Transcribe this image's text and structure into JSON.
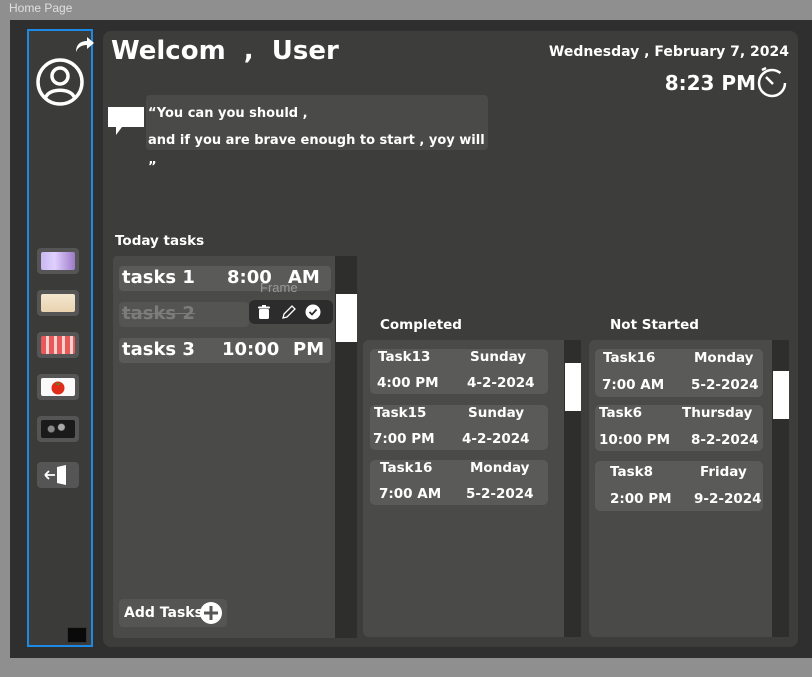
{
  "window": {
    "title": "Home Page"
  },
  "header": {
    "welcome": "Welcom  ,  User",
    "date": "Wednesday , February 7, 2024",
    "time": "8:23 PM"
  },
  "quote": {
    "line1": "“You can you should ,",
    "line2": "and if you are brave enough to start , yoy will ”"
  },
  "sidebar": {
    "items": [
      "tasks-image",
      "notes-image",
      "calendar-image",
      "pomodoro-image",
      "team-image"
    ],
    "logout_icon": "logout-icon"
  },
  "today": {
    "title": "Today tasks",
    "frame_label": "Frame",
    "items": [
      {
        "name": "tasks 1",
        "time": "8:00",
        "ampm": "AM"
      },
      {
        "name": "tasks 2",
        "time": "",
        "ampm": ""
      },
      {
        "name": "tasks 3",
        "time": "10:00",
        "ampm": "PM"
      }
    ],
    "add_label": "Add Tasks"
  },
  "completed": {
    "title": "Completed",
    "tasks": [
      {
        "name": "Task13",
        "day": "Sunday",
        "time": "4:00 PM",
        "date": "4-2-2024"
      },
      {
        "name": "Task15",
        "day": "Sunday",
        "time": "7:00 PM",
        "date": "4-2-2024"
      },
      {
        "name": "Task16",
        "day": "Monday",
        "time": "7:00 AM",
        "date": "5-2-2024"
      }
    ]
  },
  "not_started": {
    "title": "Not Started",
    "tasks": [
      {
        "name": "Task16",
        "day": "Monday",
        "time": "7:00 AM",
        "date": "5-2-2024"
      },
      {
        "name": "Task6",
        "day": "Thursday",
        "time": "10:00 PM",
        "date": "8-2-2024"
      },
      {
        "name": "Task8",
        "day": "Friday",
        "time": "2:00 PM",
        "date": "9-2-2024"
      }
    ]
  },
  "colors": {
    "accent": "#1e88e5",
    "panel": "#4a4a48",
    "card": "#5a5a58"
  }
}
